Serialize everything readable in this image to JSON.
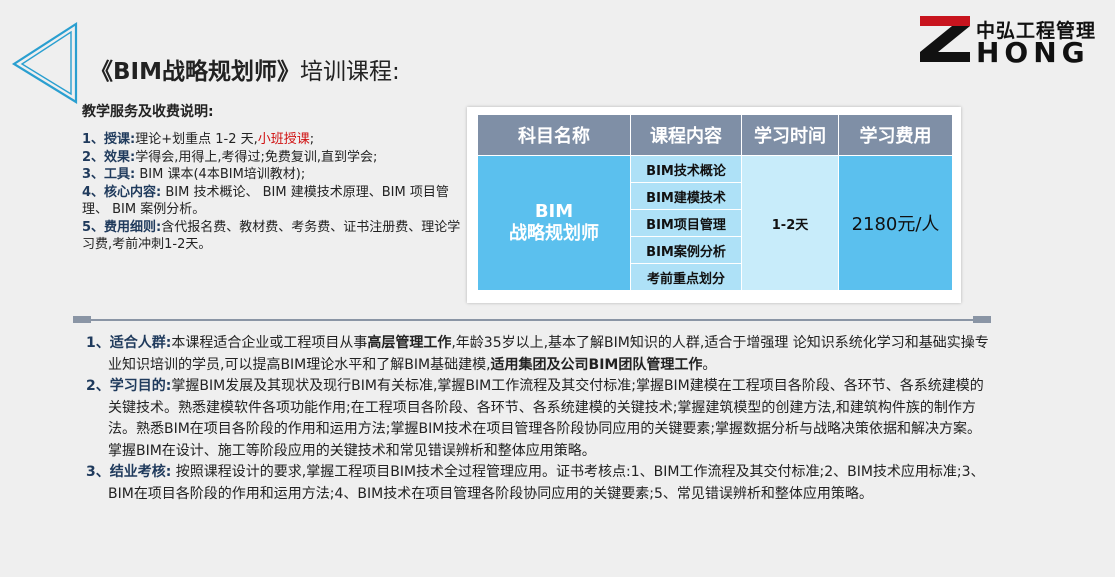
{
  "header": {
    "title_bold": "《BIM战略规划师》",
    "title_rest": "培训课程:",
    "brand_cn": "中弘工程管理",
    "brand_en": "HONG"
  },
  "services": {
    "heading": "教学服务及收费说明:",
    "items": [
      {
        "label": "1、授课:",
        "text": "理论+划重点 1-2 天,",
        "highlight": "小班授课",
        "tail": ";"
      },
      {
        "label": "2、效果:",
        "text": "学得会,用得上,考得过;免费复训,直到学会;"
      },
      {
        "label": "3、工具:",
        "text": " BIM 课本(4本BIM培训教材);"
      },
      {
        "label": "4、核心内容:",
        "text": " BIM 技术概论、 BIM 建模技术原理、BIM 项目管理、 BIM 案例分析。"
      },
      {
        "label": "5、费用细则:",
        "text": "含代报名费、教材费、考务费、证书注册费、理论学习费,考前冲刺1-2天。"
      }
    ]
  },
  "table": {
    "headers": [
      "科目名称",
      "课程内容",
      "学习时间",
      "学习费用"
    ],
    "subject_line1": "BIM",
    "subject_line2": "战略规划师",
    "contents": [
      "BIM技术概论",
      "BIM建模技术",
      "BIM项目管理",
      "BIM案例分析",
      "考前重点划分"
    ],
    "time": "1-2天",
    "fee": "2180元/人"
  },
  "details": {
    "audience": {
      "label": "1、适合人群:",
      "t1": "本课程适合企业或工程项目从事",
      "b1": "高层管理工作",
      "t2": ",年龄35岁以上,基本了解BIM知识的人群,适合于增强理 论知识系统化学习和基础实操专业知识培训的学员,可以提高BIM理论水平和了解BIM基础建模,",
      "b2": "适用集团及公司BIM团队管理工作",
      "t3": "。"
    },
    "goal": {
      "label": "2、学习目的:",
      "text": "掌握BIM发展及其现状及现行BIM有关标准,掌握BIM工作流程及其交付标准;掌握BIM建模在工程项目各阶段、各环节、各系统建模的关键技术。熟悉建模软件各项功能作用;在工程项目各阶段、各环节、各系统建模的关键技术;掌握建筑模型的创建方法,和建筑构件族的制作方法。熟悉BIM在项目各阶段的作用和运用方法;掌握BIM技术在项目管理各阶段协同应用的关键要素;掌握数据分析与战略决策依据和解决方案。掌握BIM在设计、施工等阶段应用的关键技术和常见错误辨析和整体应用策略。"
    },
    "exam": {
      "label": "3、结业考核:",
      "text": " 按照课程设计的要求,掌握工程项目BIM技术全过程管理应用。证书考核点:1、BIM工作流程及其交付标准;2、BIM技术应用标准;3、BIM在项目各阶段的作用和运用方法;4、BIM技术在项目管理各阶段协同应用的关键要素;5、常见错误辨析和整体应用策略。"
    }
  },
  "colors": {
    "accent_blue": "#5bc0ee",
    "header_gray": "#7f8fa6",
    "label_navy": "#1f3a5c",
    "highlight_red": "#d01010",
    "triangle": "#2a9fd0"
  }
}
